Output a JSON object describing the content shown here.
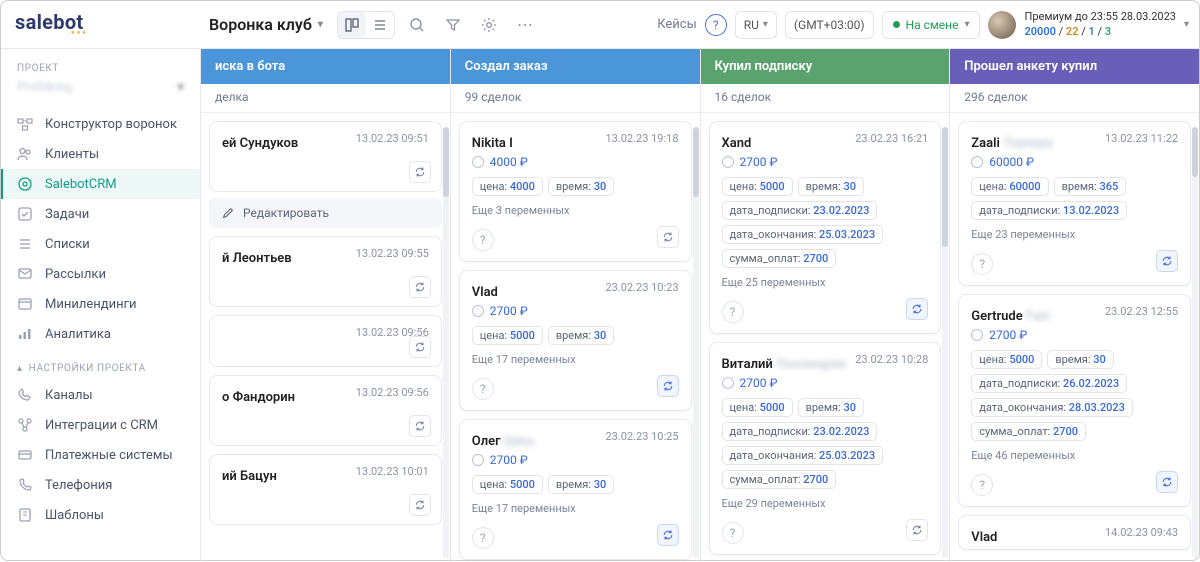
{
  "logo": "salebot",
  "funnel": "Воронка клуб",
  "topbar": {
    "cases": "Кейсы",
    "lang": "RU",
    "tz": "(GMT+03:00)",
    "shift": "На смене"
  },
  "account": {
    "premium": "Премиум до 23:55 28.03.2023",
    "credit": "20000",
    "v1": "22",
    "v2": "1",
    "v3": "3"
  },
  "sidebar": {
    "heading_project": "ПРОЕКТ",
    "project_name": "Profitking",
    "heading_settings": "НАСТРОЙКИ ПРОЕКТА",
    "items": [
      "Конструктор воронок",
      "Клиенты",
      "SalebotCRM",
      "Задачи",
      "Списки",
      "Рассылки",
      "Минилендинги",
      "Аналитика"
    ],
    "settings": [
      "Каналы",
      "Интеграции с CRM",
      "Платежные системы",
      "Телефония",
      "Шаблоны"
    ]
  },
  "columns": [
    {
      "header": "иска в бота",
      "count": "делка",
      "hdr_class": "hdr-blue",
      "edit_label": "Редактировать",
      "rows": [
        {
          "name": "ей Сундуков",
          "date": "13.02.23 09:51",
          "blur": true
        },
        {
          "name": "й Леонтьев",
          "date": "13.02.23 09:55"
        },
        {
          "name": "",
          "date": "13.02.23 09:56"
        },
        {
          "name": "о Фандорин",
          "date": "13.02.23 09:56"
        },
        {
          "name": "ий Бацун",
          "date": "13.02.23 10:01"
        }
      ]
    },
    {
      "header": "Создал заказ",
      "count": "99 сделок",
      "hdr_class": "hdr-blue",
      "cards": [
        {
          "title": "Nikita I",
          "date": "13.02.23 19:18",
          "amount": "4000 ₽",
          "tags": [
            [
              "цена:",
              "4000"
            ],
            [
              "время:",
              "30"
            ]
          ],
          "more": "Еще 3 переменных",
          "accent": false
        },
        {
          "title": "Vlad",
          "date": "23.02.23 10:23",
          "amount": "2700 ₽",
          "tags": [
            [
              "цена:",
              "5000"
            ],
            [
              "время:",
              "30"
            ]
          ],
          "more": "Еще 17 переменных",
          "accent": true
        },
        {
          "title": "Олег",
          "suffix_blur": "Шиш",
          "date": "23.02.23 10:25",
          "amount": "2700 ₽",
          "tags": [
            [
              "цена:",
              "5000"
            ],
            [
              "время:",
              "30"
            ]
          ],
          "more": "Еще 17 переменных",
          "accent": true
        }
      ]
    },
    {
      "header": "Купил подписку",
      "count": "16 сделок",
      "hdr_class": "hdr-green",
      "cards": [
        {
          "title": "Xand",
          "date": "23.02.23 16:21",
          "amount": "2700 ₽",
          "tags": [
            [
              "цена:",
              "5000"
            ],
            [
              "время:",
              "30"
            ],
            [
              "дата_подписки:",
              "23.02.2023"
            ],
            [
              "дата_окончания:",
              "25.03.2023"
            ],
            [
              "сумма_оплат:",
              "2700"
            ]
          ],
          "more": "Еще 25 переменных",
          "accent": true
        },
        {
          "title": "Виталий",
          "suffix_blur": "Пономарев",
          "date": "23.02.23 10:28",
          "amount": "2700 ₽",
          "tags": [
            [
              "цена:",
              "5000"
            ],
            [
              "время:",
              "30"
            ],
            [
              "дата_подписки:",
              "23.02.2023"
            ],
            [
              "дата_окончания:",
              "25.03.2023"
            ],
            [
              "сумма_оплат:",
              "2700"
            ]
          ],
          "more": "Еще 29 переменных",
          "accent": false
        }
      ]
    },
    {
      "header": "Прошел анкету купил",
      "count": "296 сделок",
      "hdr_class": "hdr-purple",
      "cards": [
        {
          "title": "Zaali",
          "suffix_blur": "Тхапава",
          "date": "13.02.23 11:22",
          "amount": "60000 ₽",
          "tags": [
            [
              "цена:",
              "60000"
            ],
            [
              "время:",
              "365"
            ],
            [
              "дата_подписки:",
              "13.02.2023"
            ]
          ],
          "more": "Еще 23 переменных",
          "accent": true
        },
        {
          "title": "Gertrude",
          "suffix_blur": "Fain",
          "date": "23.02.23 12:55",
          "amount": "2700 ₽",
          "tags": [
            [
              "цена:",
              "5000"
            ],
            [
              "время:",
              "30"
            ],
            [
              "дата_подписки:",
              "26.02.2023"
            ],
            [
              "дата_окончания:",
              "28.03.2023"
            ],
            [
              "сумма_оплат:",
              "2700"
            ]
          ],
          "more": "Еще 46 переменных",
          "accent": true
        },
        {
          "title": "Vlad",
          "date": "14.02.23 09:43",
          "partial": true
        }
      ]
    }
  ]
}
